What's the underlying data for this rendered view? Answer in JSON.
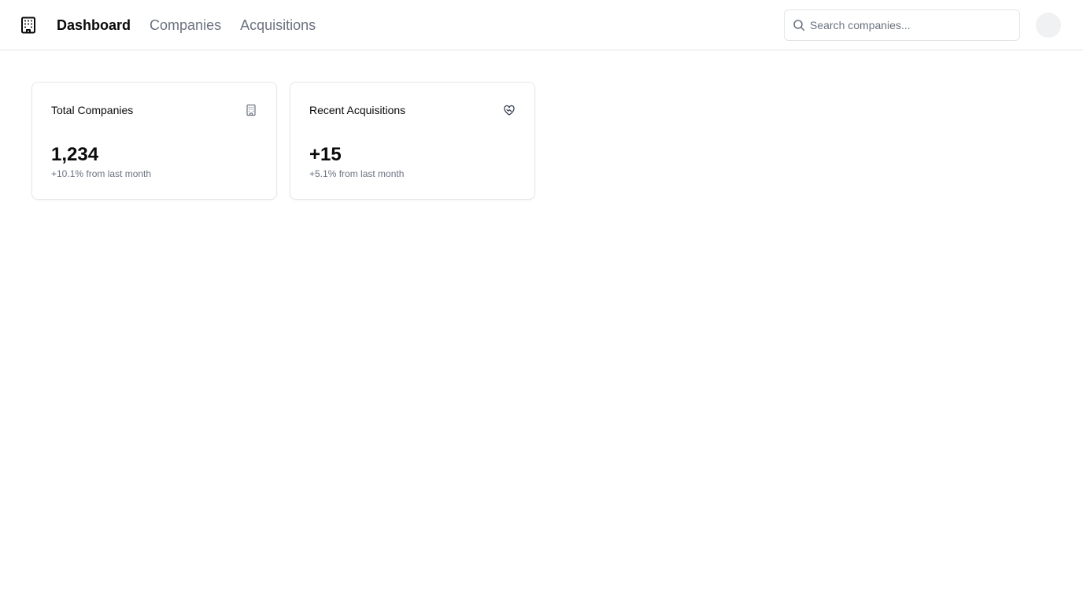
{
  "header": {
    "logo_icon": "building-icon",
    "nav": [
      {
        "label": "Dashboard",
        "active": true
      },
      {
        "label": "Companies",
        "active": false
      },
      {
        "label": "Acquisitions",
        "active": false
      }
    ],
    "search": {
      "placeholder": "Search companies...",
      "value": "",
      "icon": "search-icon"
    },
    "avatar": {
      "icon": "avatar"
    }
  },
  "cards": [
    {
      "title": "Total Companies",
      "value": "1,234",
      "delta": "+10.1% from last month",
      "icon": "building-icon"
    },
    {
      "title": "Recent Acquisitions",
      "value": "+15",
      "delta": "+5.1% from last month",
      "icon": "handshake-heart-icon"
    }
  ],
  "colors": {
    "text_primary": "#0a0a0a",
    "text_muted": "#6b7280",
    "border": "#e5e7eb"
  }
}
